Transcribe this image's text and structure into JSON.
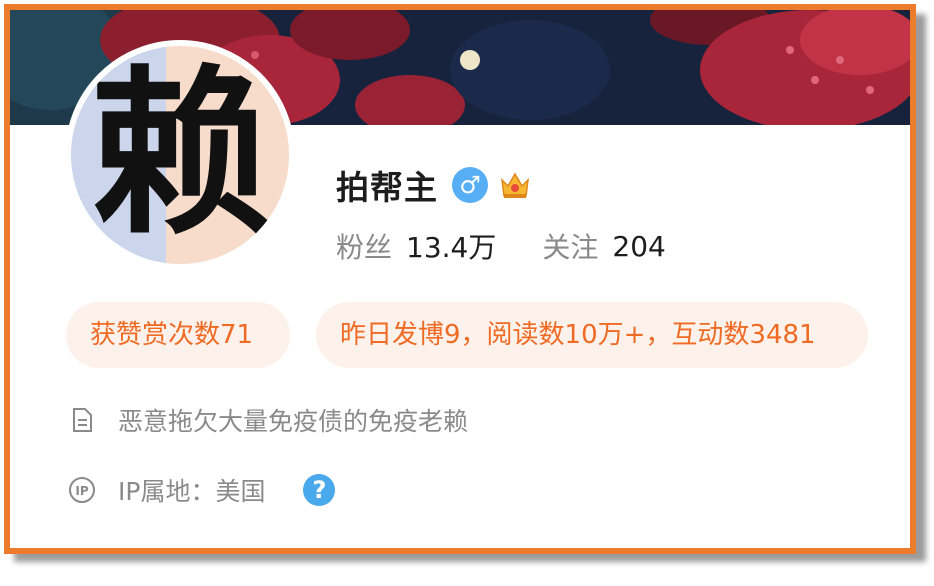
{
  "profile": {
    "name": "拍帮主",
    "gender_icon": "male-icon",
    "gender_glyph": "♂",
    "badge_icon": "vip-crown-icon",
    "avatar_text": "赖",
    "stats": {
      "followers_label": "粉丝",
      "followers_value": "13.4万",
      "following_label": "关注",
      "following_value": "204"
    },
    "pills": {
      "likes": "获赞赏次数71",
      "activity": "昨日发博9，阅读数10万+，互动数3481"
    },
    "description": "恶意拖欠大量免疫债的免疫老赖",
    "ip_location": "IP属地：美国",
    "help_glyph": "?"
  },
  "colors": {
    "accent_border": "#ec7b2c",
    "pill_text": "#ef6b23",
    "pill_bg": "#fdf1eb",
    "gender_badge": "#57aef5",
    "help_badge": "#4aa8ec"
  }
}
